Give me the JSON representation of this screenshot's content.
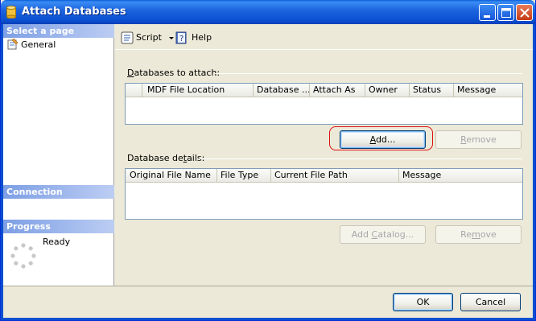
{
  "window": {
    "title": "Attach Databases"
  },
  "nav": {
    "select_page_header": "Select a page",
    "items": [
      {
        "label": "General"
      }
    ],
    "connection_header": "Connection",
    "progress_header": "Progress",
    "progress_status": "Ready"
  },
  "toolbar": {
    "script_label": "Script",
    "help_label": "Help"
  },
  "attach_group": {
    "label_pre": "",
    "label_mnemonic": "D",
    "label_post": "atabases to attach:",
    "columns": [
      "",
      "MDF File Location",
      "Database ...",
      "Attach As",
      "Owner",
      "Status",
      "Message"
    ],
    "rows": [],
    "add_pre": "",
    "add_mnemonic": "A",
    "add_post": "dd...",
    "remove_pre": "",
    "remove_mnemonic": "R",
    "remove_post": "emove"
  },
  "details_group": {
    "label_pre": "Database de",
    "label_mnemonic": "t",
    "label_post": "ails:",
    "columns": [
      "Original File Name",
      "File Type",
      "Current File Path",
      "Message"
    ],
    "rows": [],
    "add_catalog_pre": "Add ",
    "add_catalog_mnemonic": "C",
    "add_catalog_post": "atalog...",
    "remove_pre": "Re",
    "remove_mnemonic": "m",
    "remove_post": "ove"
  },
  "footer": {
    "ok_label": "OK",
    "cancel_label": "Cancel"
  },
  "colors": {
    "titlebar": "#0a4fd0",
    "window_bg": "#ece9d8",
    "nav_header": "#7d9fe5",
    "highlight_ring": "#dd1111"
  },
  "icons": {
    "app": "database-cylinder-icon",
    "general": "properties-page-icon",
    "script": "script-icon",
    "help": "help-book-icon",
    "progress": "spinner-icon"
  }
}
